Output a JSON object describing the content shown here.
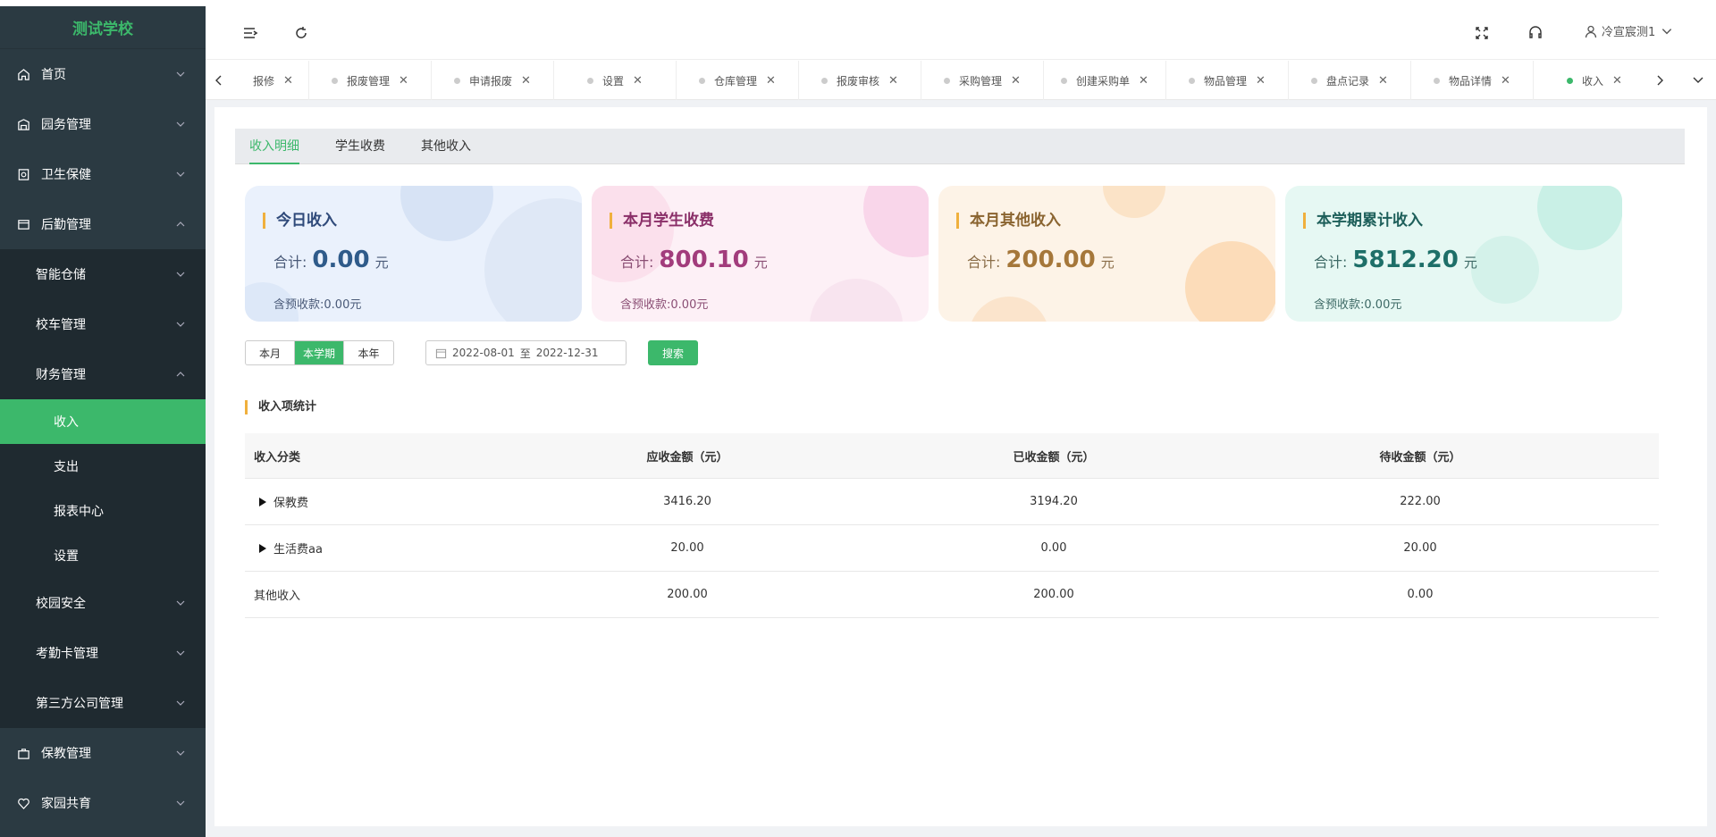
{
  "app": {
    "school_name": "测试学校"
  },
  "sidebar": {
    "items": [
      {
        "label": "首页"
      },
      {
        "label": "园务管理"
      },
      {
        "label": "卫生保健"
      },
      {
        "label": "后勤管理"
      },
      {
        "label": "智能仓储"
      },
      {
        "label": "校车管理"
      },
      {
        "label": "财务管理"
      },
      {
        "label": "收入"
      },
      {
        "label": "支出"
      },
      {
        "label": "报表中心"
      },
      {
        "label": "设置"
      },
      {
        "label": "校园安全"
      },
      {
        "label": "考勤卡管理"
      },
      {
        "label": "第三方公司管理"
      },
      {
        "label": "保教管理"
      },
      {
        "label": "家园共育"
      }
    ]
  },
  "header": {
    "user_name": "冷宣宸测1"
  },
  "tabs": [
    {
      "label": "报修"
    },
    {
      "label": "报废管理"
    },
    {
      "label": "申请报废"
    },
    {
      "label": "设置"
    },
    {
      "label": "仓库管理"
    },
    {
      "label": "报废审核"
    },
    {
      "label": "采购管理"
    },
    {
      "label": "创建采购单"
    },
    {
      "label": "物品管理"
    },
    {
      "label": "盘点记录"
    },
    {
      "label": "物品详情"
    },
    {
      "label": "收入"
    }
  ],
  "tab_close_glyph": "✕",
  "subtabs": [
    {
      "label": "收入明细"
    },
    {
      "label": "学生收费"
    },
    {
      "label": "其他收入"
    }
  ],
  "cards": [
    {
      "title": "今日收入",
      "total_label": "合计:",
      "value": "0.00",
      "unit": "元",
      "pre_label": "含预收款:",
      "pre_value": "0.00元",
      "color": "#2f5b8a"
    },
    {
      "title": "本月学生收费",
      "total_label": "合计:",
      "value": "800.10",
      "unit": "元",
      "pre_label": "含预收款:",
      "pre_value": "0.00元",
      "color": "#a23c7c"
    },
    {
      "title": "本月其他收入",
      "total_label": "合计:",
      "value": "200.00",
      "unit": "元",
      "pre_label": "",
      "pre_value": "",
      "color": "#a5773a"
    },
    {
      "title": "本学期累计收入",
      "total_label": "合计:",
      "value": "5812.20",
      "unit": "元",
      "pre_label": "含预收款:",
      "pre_value": "0.00元",
      "color": "#1d6f68"
    }
  ],
  "filter": {
    "periods": [
      "本月",
      "本学期",
      "本年"
    ],
    "date_start": "2022-08-01",
    "date_sep": "至",
    "date_end": "2022-12-31",
    "search_label": "搜索"
  },
  "section_title": "收入项统计",
  "table": {
    "headers": [
      "收入分类",
      "应收金额（元）",
      "已收金额（元）",
      "待收金额（元）"
    ],
    "rows": [
      [
        "保教费",
        "3416.20",
        "3194.20",
        "222.00"
      ],
      [
        "生活费aa",
        "20.00",
        "0.00",
        "20.00"
      ],
      [
        "其他收入",
        "200.00",
        "200.00",
        "0.00"
      ]
    ]
  },
  "colors": {
    "accent": "#3cb86b",
    "sidebar": "#2b3a42",
    "marker": "#f0b03d"
  }
}
